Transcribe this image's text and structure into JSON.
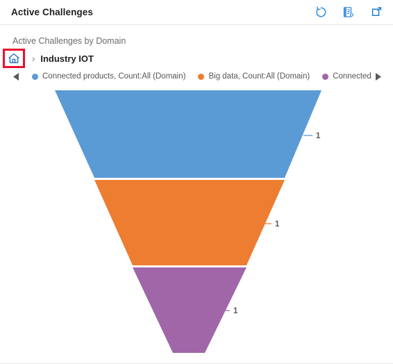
{
  "header": {
    "title": "Active Challenges",
    "actions": [
      {
        "name": "refresh-icon",
        "label": "Refresh"
      },
      {
        "name": "export-report-icon",
        "label": "Export"
      },
      {
        "name": "expand-icon",
        "label": "Expand"
      }
    ]
  },
  "chart_title": "Active Challenges by Domain",
  "breadcrumb": {
    "home_label": "Home",
    "separator": "›",
    "current": "Industry IOT",
    "highlight_color": "#e8112d"
  },
  "legend": {
    "prev_arrow": "◀",
    "next_arrow": "▶",
    "items": [
      {
        "label": "Connected products, Count:All (Domain)",
        "color": "#5B9BD5"
      },
      {
        "label": "Big data, Count:All (Domain)",
        "color": "#ED7D31"
      },
      {
        "label": "Connected Opera",
        "color": "#A066A8"
      }
    ]
  },
  "chart_data": {
    "type": "funnel",
    "title": "Active Challenges by Domain",
    "categories": [
      "Connected products, Count:All (Domain)",
      "Big data, Count:All (Domain)",
      "Connected Opera"
    ],
    "values": [
      1,
      1,
      1
    ],
    "labels": [
      "1",
      "1",
      "1"
    ],
    "colors": [
      "#5B9BD5",
      "#ED7D31",
      "#A066A8"
    ],
    "xlabel": "",
    "ylabel": "",
    "legend_position": "top",
    "grid": false
  }
}
